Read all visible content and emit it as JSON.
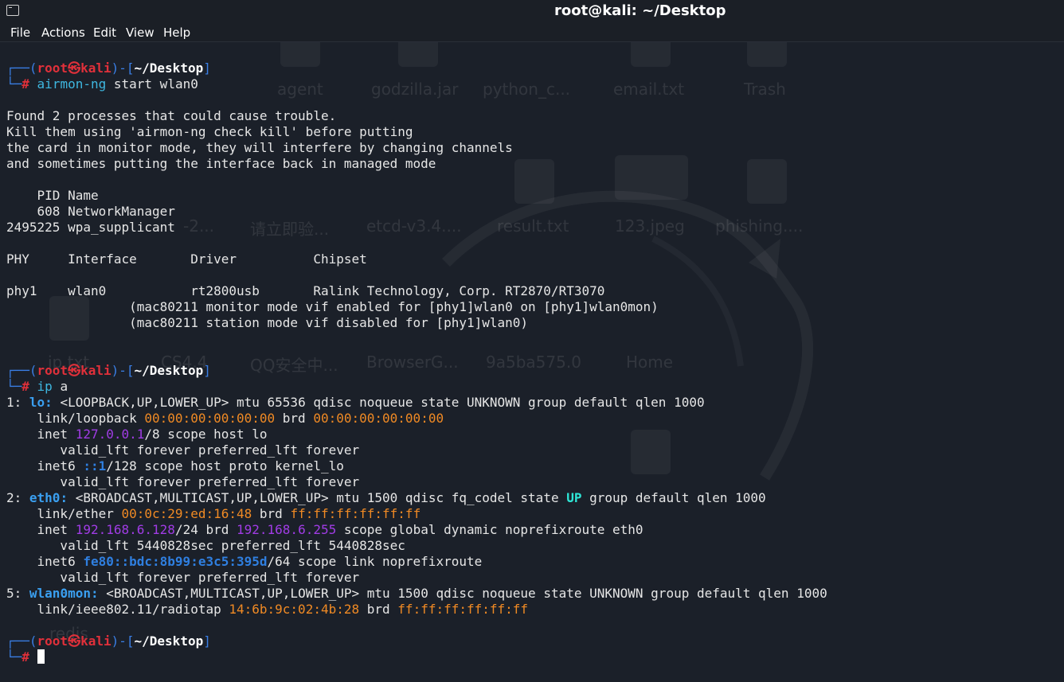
{
  "window": {
    "title": "root@kali: ~/Desktop"
  },
  "menu": [
    "File",
    "Actions",
    "Edit",
    "View",
    "Help"
  ],
  "desktop_labels": {
    "row1": [
      "agent",
      "godzilla.jar",
      "python_c...",
      "email.txt",
      "Trash"
    ],
    "row2": [
      "-2...",
      "请立即验...",
      "etcd-v3.4....",
      "result.txt",
      "123.jpeg",
      "phishing...."
    ],
    "row3": [
      "ip.txt",
      "CS4.4",
      "QQ安全中...",
      "BrowserG...",
      "9a5ba575.0",
      "Home"
    ],
    "row4": [
      "redis"
    ]
  },
  "prompt": {
    "open": "┌──(",
    "user": "root",
    "at": "㉿",
    "host": "kali",
    "mid": ")-[",
    "path": "~/Desktop",
    "close": "]",
    "corner": "└─",
    "hash": "#"
  },
  "cmd1": {
    "program": "airmon-ng",
    "args": " start wlan0"
  },
  "output1": [
    "",
    "Found 2 processes that could cause trouble.",
    "Kill them using 'airmon-ng check kill' before putting",
    "the card in monitor mode, they will interfere by changing channels",
    "and sometimes putting the interface back in managed mode",
    "",
    "    PID Name",
    "    608 NetworkManager",
    "2495225 wpa_supplicant",
    "",
    "PHY     Interface       Driver          Chipset",
    "",
    "phy1    wlan0           rt2800usb       Ralink Technology, Corp. RT2870/RT3070",
    "                (mac80211 monitor mode vif enabled for [phy1]wlan0 on [phy1]wlan0mon)",
    "                (mac80211 station mode vif disabled for [phy1]wlan0)",
    "",
    ""
  ],
  "cmd2": {
    "program": "ip",
    "args": " a"
  },
  "ip_output": {
    "lo": {
      "idx": "1: ",
      "name": "lo:",
      "flags": " <LOOPBACK,UP,LOWER_UP> mtu 65536 qdisc noqueue state UNKNOWN group default qlen 1000",
      "link_pre": "    link/loopback ",
      "mac": "00:00:00:00:00:00",
      "brd_label": " brd ",
      "brd": "00:00:00:00:00:00",
      "inet_pre": "    inet ",
      "inet": "127.0.0.1",
      "inet_post": "/8 scope host lo",
      "valid1": "       valid_lft forever preferred_lft forever",
      "inet6_pre": "    inet6 ",
      "inet6": "::1",
      "inet6_post": "/128 scope host proto kernel_lo",
      "valid2": "       valid_lft forever preferred_lft forever"
    },
    "eth0": {
      "idx": "2: ",
      "name": "eth0:",
      "flags_pre": " <BROADCAST,MULTICAST,UP,LOWER_UP> mtu 1500 qdisc fq_codel state ",
      "state": "UP",
      "flags_post": " group default qlen 1000",
      "link_pre": "    link/ether ",
      "mac": "00:0c:29:ed:16:48",
      "brd_label": " brd ",
      "brd": "ff:ff:ff:ff:ff:ff",
      "inet_pre": "    inet ",
      "inet": "192.168.6.128",
      "inet_mid": "/24 brd ",
      "inet_brd": "192.168.6.255",
      "inet_post": " scope global dynamic noprefixroute eth0",
      "valid1": "       valid_lft 5440828sec preferred_lft 5440828sec",
      "inet6_pre": "    inet6 ",
      "inet6": "fe80::bdc:8b99:e3c5:395d",
      "inet6_post": "/64 scope link noprefixroute",
      "valid2": "       valid_lft forever preferred_lft forever"
    },
    "wlan0mon": {
      "idx": "5: ",
      "name": "wlan0mon:",
      "flags": " <BROADCAST,MULTICAST,UP,LOWER_UP> mtu 1500 qdisc noqueue state UNKNOWN group default qlen 1000",
      "link_pre": "    link/ieee802.11/radiotap ",
      "mac": "14:6b:9c:02:4b:28",
      "brd_label": " brd ",
      "brd": "ff:ff:ff:ff:ff:ff"
    }
  },
  "colors": {
    "background": "#1b2029",
    "prompt_frame": "#3a7fe6",
    "prompt_user": "#e0303a",
    "mac": "#f08a24",
    "ip": "#a13ce6",
    "command": "#3eb7e0"
  }
}
